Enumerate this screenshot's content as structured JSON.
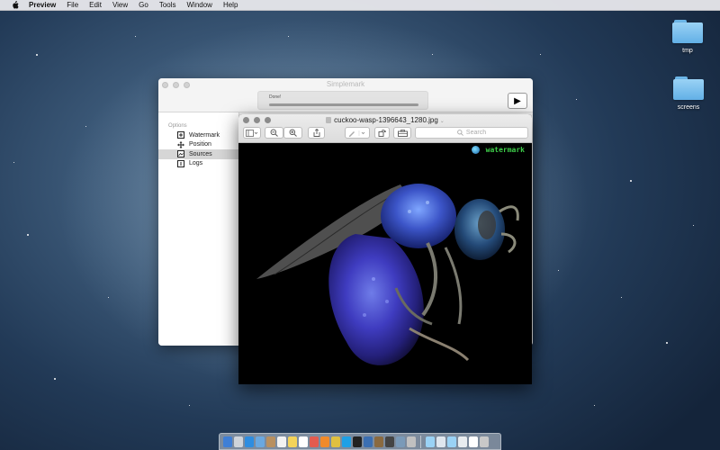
{
  "menubar": {
    "items": [
      "Preview",
      "File",
      "Edit",
      "View",
      "Go",
      "Tools",
      "Window",
      "Help"
    ]
  },
  "desktop": {
    "icons": [
      {
        "label": "tmp",
        "icon": "folder-icon"
      },
      {
        "label": "screens",
        "icon": "folder-icon"
      }
    ]
  },
  "simplemark": {
    "title": "Simplemark",
    "status": "Done!",
    "progress": 1.0,
    "run_button_icon": "play-icon",
    "sidebar": {
      "section": "Options",
      "items": [
        {
          "label": "Watermark",
          "icon": "watermark-icon",
          "selected": false
        },
        {
          "label": "Position",
          "icon": "move-icon",
          "selected": false
        },
        {
          "label": "Sources",
          "icon": "sources-icon",
          "selected": true
        },
        {
          "label": "Logs",
          "icon": "logs-icon",
          "selected": false
        }
      ]
    }
  },
  "preview": {
    "title": "cuckoo-wasp-1396643_1280.jpg",
    "search_placeholder": "Search",
    "watermark_text": "watermark",
    "accent_color": "#3ecf4a"
  },
  "dock": {
    "icons": [
      "finder-icon",
      "launchpad-icon",
      "safari-icon",
      "mail-icon",
      "contacts-icon",
      "calendar-icon",
      "notes-icon",
      "reminders-icon",
      "photos-icon",
      "firefox-icon",
      "chrome-icon",
      "skype-icon",
      "terminal-icon",
      "xcode-icon",
      "app-icon",
      "app-icon",
      "app-icon",
      "app-icon",
      "folder-icon",
      "folder-icon",
      "folder-icon",
      "folder-icon",
      "folder-icon",
      "trash-icon"
    ]
  }
}
